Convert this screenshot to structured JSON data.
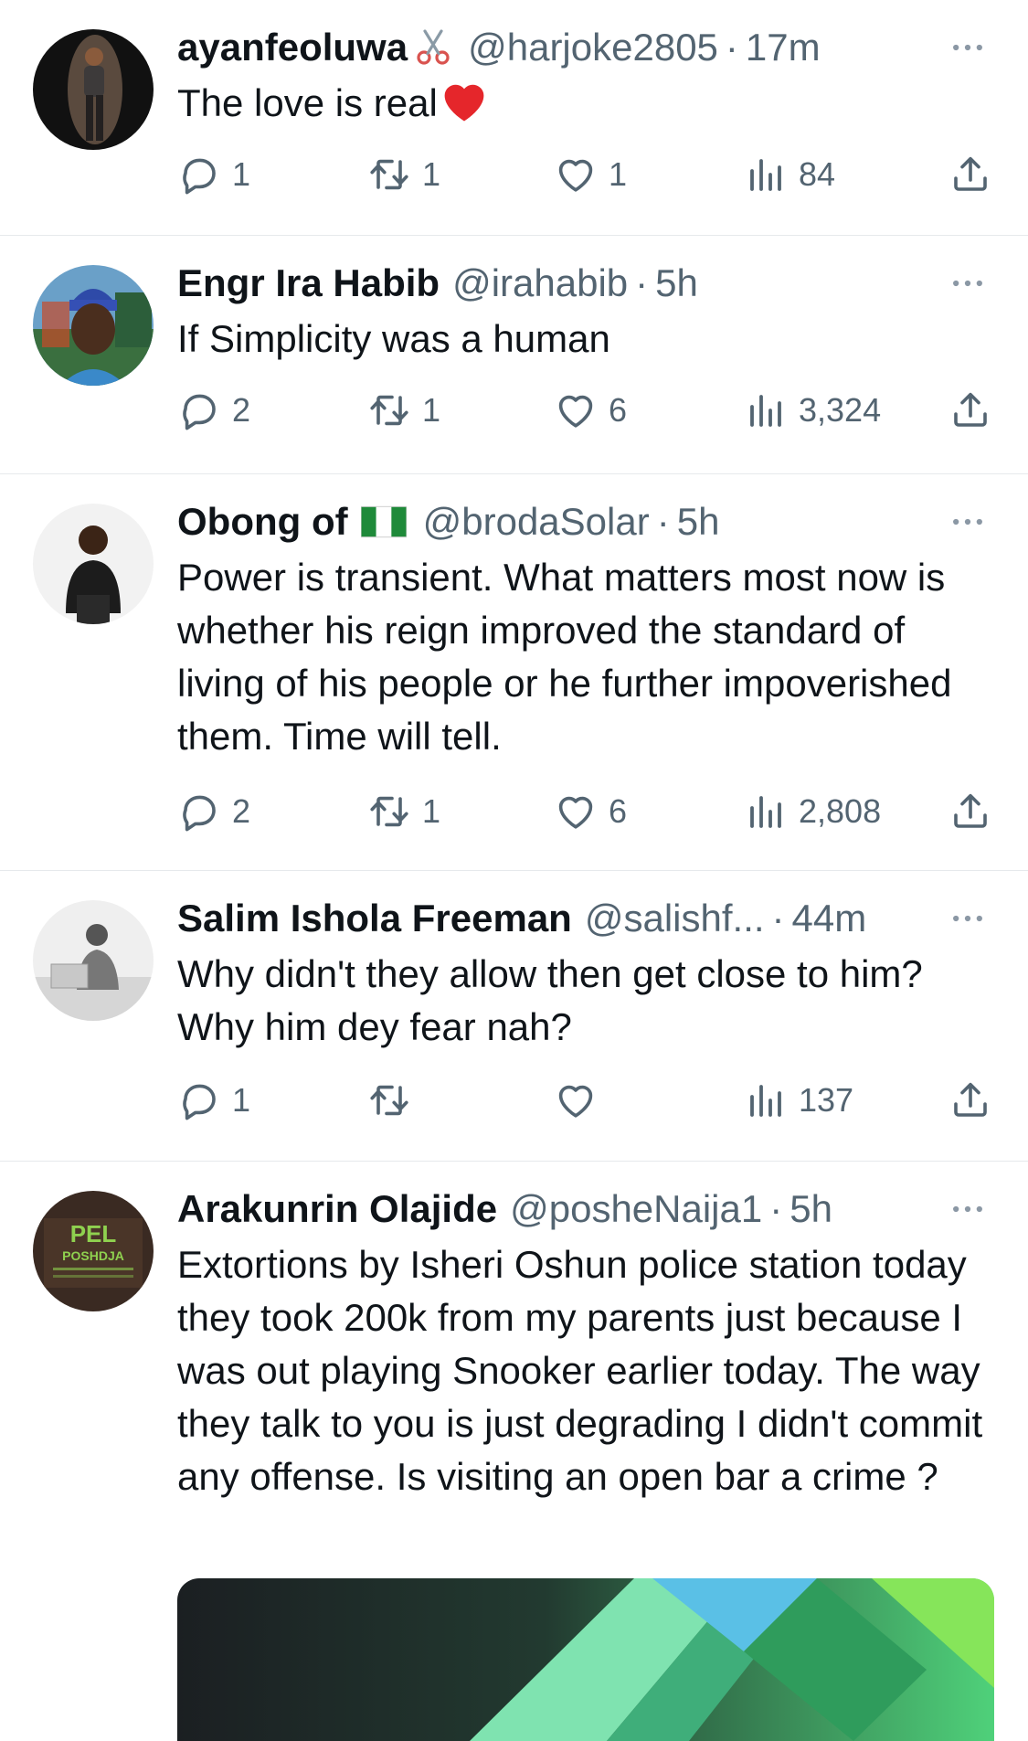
{
  "tweets": [
    {
      "name": "ayanfeoluwa",
      "name_emoji": "scissors-emoji",
      "handle": "@harjoke2805",
      "separator": "·",
      "time": "17m",
      "text": "The love is real",
      "text_emoji": "red-heart-emoji",
      "replies": "1",
      "retweets": "1",
      "likes": "1",
      "views": "84"
    },
    {
      "name": "Engr Ira Habib",
      "handle": "@irahabib",
      "separator": "·",
      "time": "5h",
      "text": "If Simplicity was a human",
      "replies": "2",
      "retweets": "1",
      "likes": "6",
      "views": "3,324"
    },
    {
      "name": "Obong of",
      "name_emoji": "nigeria-flag-emoji",
      "handle": "@brodaSolar",
      "separator": "·",
      "time": "5h",
      "text": "Power is transient. What matters most now is whether his reign improved the standard of living of his people or he further impoverished them. Time will tell.",
      "replies": "2",
      "retweets": "1",
      "likes": "6",
      "views": "2,808"
    },
    {
      "name": "Salim Ishola Freeman",
      "handle": "@salishf...",
      "separator": "·",
      "time": "44m",
      "text": "Why didn't they allow then get close to him? Why him dey fear nah?",
      "replies": "1",
      "retweets": "",
      "likes": "",
      "views": "137"
    },
    {
      "name": "Arakunrin Olajide",
      "handle": "@posheNaija1",
      "separator": "·",
      "time": "5h",
      "text": "Extortions by Isheri Oshun police station today they took 200k from my parents just because I was out playing Snooker earlier today. The way they talk to you is just degrading I didn't commit any offense. Is visiting an open bar a crime ?",
      "avatar_text": "PEL",
      "avatar_subtext": "POSHDJA",
      "replies": "",
      "retweets": "",
      "likes": "",
      "views": ""
    }
  ],
  "colors": {
    "text_primary": "#0f1419",
    "text_secondary": "#536471",
    "divider": "#e6e9ec"
  }
}
